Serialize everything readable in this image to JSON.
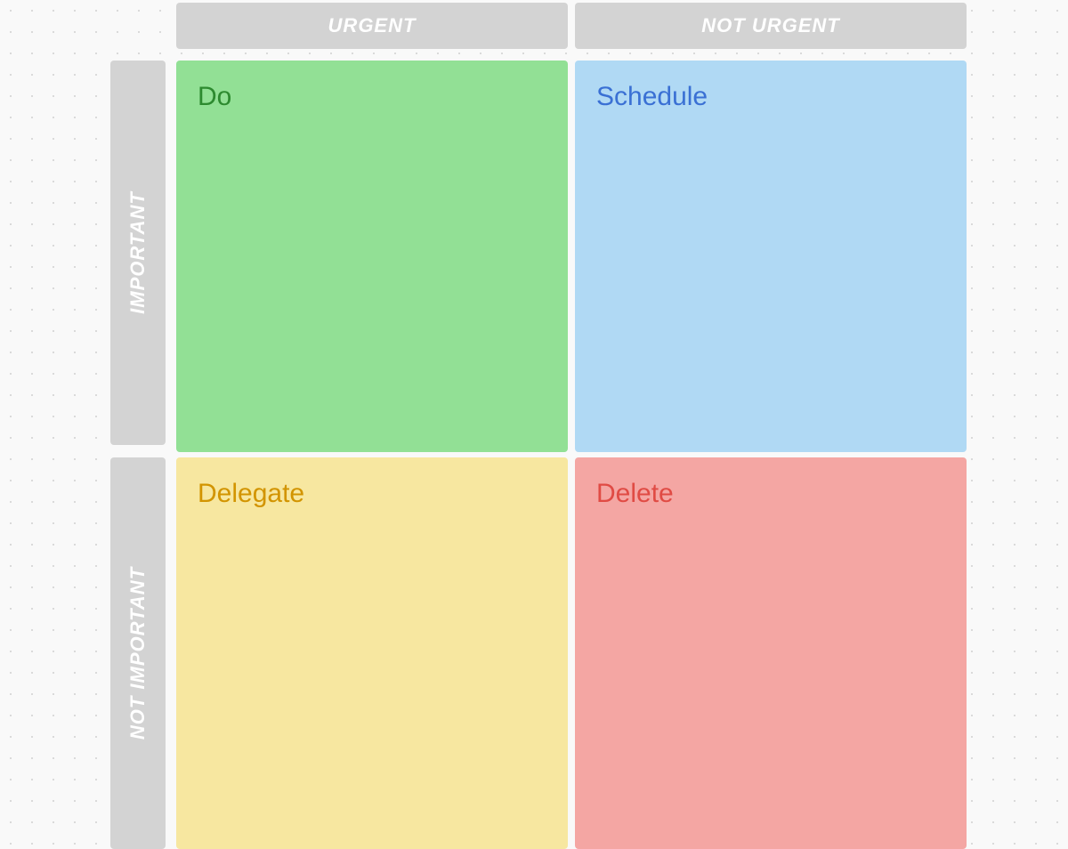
{
  "columns": {
    "urgent": "URGENT",
    "not_urgent": "NOT URGENT"
  },
  "rows": {
    "important": "IMPORTANT",
    "not_important": "NOT IMPORTANT"
  },
  "quadrants": {
    "do": {
      "label": "Do",
      "bg": "#92e095",
      "fg": "#2d8a2f"
    },
    "schedule": {
      "label": "Schedule",
      "bg": "#b0d9f4",
      "fg": "#3a70d4"
    },
    "delegate": {
      "label": "Delegate",
      "bg": "#f7e7a0",
      "fg": "#d29400"
    },
    "delete": {
      "label": "Delete",
      "bg": "#f4a6a3",
      "fg": "#e04b44"
    }
  }
}
